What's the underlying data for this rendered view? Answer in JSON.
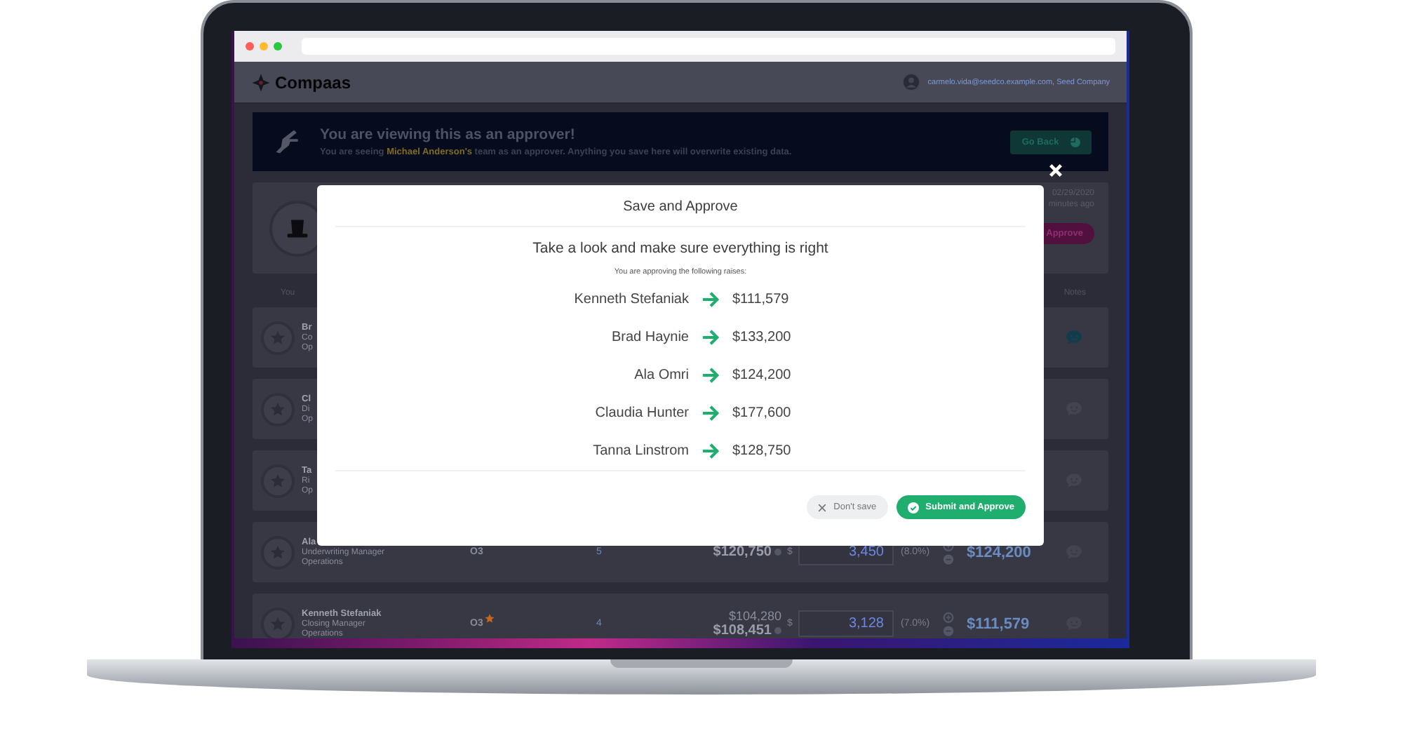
{
  "app": {
    "logo": "Compaas",
    "user": "carmelo.vida@seedco.example.com, Seed Company"
  },
  "banner": {
    "title": "You are viewing this as an approver!",
    "message": "You are seeing **Michael Anderson's** team as an approver. Anything you save here will overwrite existing data.",
    "button": "Go Back"
  },
  "summary_card": {
    "date": "02/29/2020",
    "updated": "minutes ago",
    "button": "Approve"
  },
  "table": {
    "columns": [
      "You",
      "Notes"
    ],
    "rows": [
      {
        "kind": "partial",
        "name": "Br",
        "title": "Co",
        "department": "Op",
        "note_active": true
      },
      {
        "kind": "partial",
        "name": "Cl",
        "title": "Di",
        "department": "Op",
        "note_active": false
      },
      {
        "kind": "partial",
        "name": "Ta",
        "title": "Ri",
        "department": "Op",
        "note_active": false
      },
      {
        "kind": "full",
        "name": "Ala",
        "title": "Underwriting Manager",
        "department": "Operations",
        "level": "O3",
        "starred": false,
        "rating": "5",
        "salaries": [
          "$120,750"
        ],
        "currency": "$",
        "raise": "3,450",
        "percent": "(8.0%)",
        "new_salary": "$124,200",
        "note_active": false
      },
      {
        "kind": "full",
        "name": "Kenneth Stefaniak",
        "title": "Closing Manager",
        "department": "Operations",
        "level": "O3",
        "starred": true,
        "rating": "4",
        "salaries": [
          "$104,280",
          "$108,451"
        ],
        "currency": "$",
        "raise": "3,128",
        "percent": "(7.0%)",
        "new_salary": "$111,579",
        "note_active": false
      }
    ]
  },
  "modal": {
    "title": "Save and Approve",
    "heading": "Take a look and make sure everything is right",
    "intro": "You are approving the following raises:",
    "raises": [
      {
        "name": "Kenneth Stefaniak",
        "amount": "$111,579"
      },
      {
        "name": "Brad Haynie",
        "amount": "$133,200"
      },
      {
        "name": "Ala Omri",
        "amount": "$124,200"
      },
      {
        "name": "Claudia Hunter",
        "amount": "$177,600"
      },
      {
        "name": "Tanna Linstrom",
        "amount": "$128,750"
      }
    ],
    "buttons": [
      {
        "label": "Don't save",
        "kind": "secondary"
      },
      {
        "label": "Submit and Approve",
        "kind": "primary"
      }
    ]
  }
}
